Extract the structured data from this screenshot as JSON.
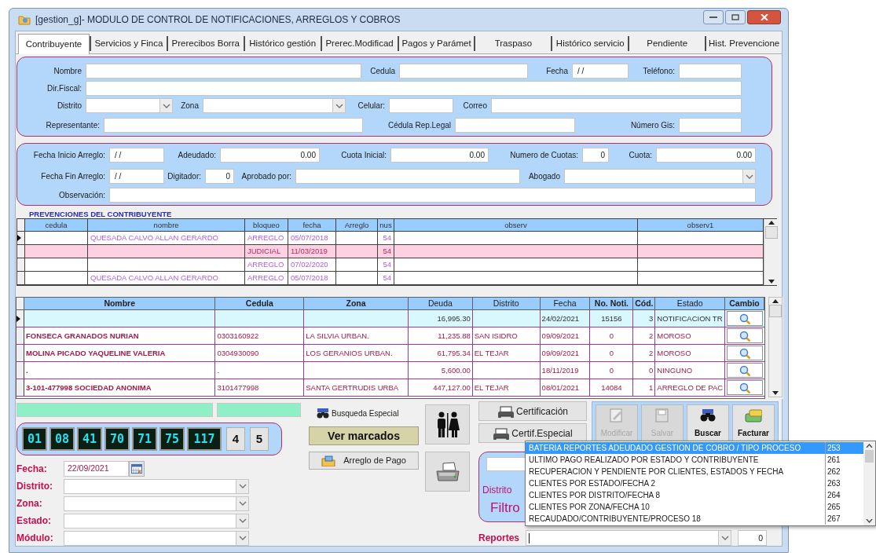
{
  "window": {
    "title": "[gestion_g]- MODULO DE CONTROL DE NOTIFICACIONES, ARREGLOS Y COBROS"
  },
  "tabs": [
    {
      "label": "Contribuyente",
      "selected": true
    },
    {
      "label": "Servicios y Finca",
      "selected": false
    },
    {
      "label": "Prerecibos Borra",
      "selected": false
    },
    {
      "label": "Histórico gestión",
      "selected": false
    },
    {
      "label": "Prerec.Modificad",
      "selected": false
    },
    {
      "label": "Pagos y Parámet",
      "selected": false
    },
    {
      "label": "Traspaso",
      "selected": false
    },
    {
      "label": "Histórico servicio",
      "selected": false
    },
    {
      "label": "Pendiente",
      "selected": false
    },
    {
      "label": "Hist. Prevencione",
      "selected": false
    }
  ],
  "contribuyente_form": {
    "lines": [
      {
        "items": [
          {
            "label": "Nombre",
            "kind": "text"
          },
          {
            "label": "Cedula",
            "kind": "text"
          },
          {
            "label": "Fecha",
            "kind": "text",
            "value": "/ /"
          },
          {
            "label": "Teléfono:",
            "kind": "text"
          }
        ]
      },
      {
        "items": [
          {
            "label": "Dir.Fiscal:",
            "kind": "text"
          }
        ]
      },
      {
        "items": [
          {
            "label": "Distrito",
            "kind": "combo"
          },
          {
            "label": "Zona",
            "kind": "combo"
          },
          {
            "label": "Celular:",
            "kind": "text"
          },
          {
            "label": "Correo",
            "kind": "text"
          }
        ]
      },
      {
        "items": [
          {
            "label": "Representante:",
            "kind": "text"
          },
          {
            "label": "Cédula Rep.Legal",
            "kind": "text"
          },
          {
            "label": "Número Gis:",
            "kind": "text"
          }
        ]
      }
    ]
  },
  "arreglo_form": {
    "lines": [
      {
        "items": [
          {
            "label": "Fecha Inicio Arreglo:",
            "kind": "text",
            "value": "/ /"
          },
          {
            "label": "Adeudado:",
            "kind": "text",
            "value": "0.00"
          },
          {
            "label": "Cuota Inicial:",
            "kind": "text",
            "value": "0.00"
          },
          {
            "label": "Numero de Cuotas:",
            "kind": "text",
            "value": "0"
          },
          {
            "label": "Cuota:",
            "kind": "text",
            "value": "0.00"
          }
        ]
      },
      {
        "items": [
          {
            "label": "Fecha Fin Arreglo:",
            "kind": "text",
            "value": "/ /"
          },
          {
            "label": "Digitador:",
            "kind": "text",
            "value": "0"
          },
          {
            "label": "Aprobado por:",
            "kind": "text"
          },
          {
            "label": "Abogado",
            "kind": "combo"
          }
        ]
      },
      {
        "items": [
          {
            "label": "Observación:",
            "kind": "text"
          }
        ]
      }
    ]
  },
  "prevenciones": {
    "title": "PREVENCIONES DEL CONTRIBUYENTE",
    "columns": [
      "cedula",
      "nombre",
      "bloqueo",
      "fecha",
      "Arreglo",
      "nus",
      "observ",
      "observ1"
    ],
    "rows": [
      {
        "current": true,
        "highlight": false,
        "cells": [
          null,
          "QUESADA CALVO ALLAN GERARDO",
          "ARREGLO",
          "05/07/2018",
          null,
          "54",
          null,
          null
        ]
      },
      {
        "current": false,
        "highlight": true,
        "cells": [
          null,
          null,
          "JUDICIAL",
          "11/03/2019",
          null,
          "54",
          null,
          null
        ]
      },
      {
        "current": false,
        "highlight": false,
        "cells": [
          null,
          null,
          "ARREGLO",
          "07/02/2020",
          null,
          "54",
          null,
          null
        ]
      },
      {
        "current": false,
        "highlight": false,
        "cells": [
          null,
          "QUESADA CALVO ALLAN GERARDO",
          "ARREGLO",
          "05/07/2018",
          null,
          "54",
          null,
          null
        ]
      }
    ]
  },
  "contribuyentes": {
    "columns": [
      {
        "label": "Nombre",
        "bold": true
      },
      {
        "label": "Cedula",
        "bold": true
      },
      {
        "label": "Zona",
        "bold": true
      },
      {
        "label": "Deuda",
        "bold": false
      },
      {
        "label": "Distrito",
        "bold": false
      },
      {
        "label": "Fecha",
        "bold": false
      },
      {
        "label": "No. Noti.",
        "bold": true
      },
      {
        "label": "Cód.",
        "bold": true
      },
      {
        "label": "Estado",
        "bold": false
      },
      {
        "label": "Cambio",
        "bold": true
      }
    ],
    "rows": [
      {
        "current": true,
        "cells": [
          null,
          null,
          null,
          "16,995.30",
          null,
          "24/02/2021",
          "15156",
          "3",
          "NOTIFICACION TR"
        ]
      },
      {
        "current": false,
        "cells": [
          "FONSECA GRANADOS NURIAN",
          "0303160922",
          "LA SILVIA URBAN.",
          "11,235.88",
          "SAN ISIDRO",
          "09/09/2021",
          "0",
          "2",
          "MOROSO"
        ]
      },
      {
        "current": false,
        "cells": [
          "MOLINA PICADO YAQUELINE VALERIA",
          "0304930090",
          "LOS GERANIOS URBAN.",
          "61,795.34",
          "EL TEJAR",
          "09/09/2021",
          "0",
          "2",
          "MOROSO"
        ]
      },
      {
        "current": false,
        "cells": [
          ".",
          ".",
          null,
          "5,600.00",
          null,
          "18/11/2019",
          "0",
          "0",
          "NINGUNO"
        ]
      },
      {
        "current": false,
        "cells": [
          "3-101-477998 SOCIEDAD ANONIMA",
          "3101477998",
          "SANTA GERTRUDIS URBA",
          "447,127.00",
          "EL TEJAR",
          "08/01/2021",
          "14084",
          "1",
          "ARREGLO DE PAC"
        ]
      }
    ]
  },
  "counter": {
    "digits": [
      "01",
      "08",
      "41",
      "70",
      "71",
      "75",
      "117"
    ],
    "boxes": [
      "4",
      "5"
    ]
  },
  "filters": [
    {
      "label": "Fecha:",
      "kind": "date",
      "value": "22/09/2021"
    },
    {
      "label": "Distrito:",
      "kind": "combo"
    },
    {
      "label": "Zona:",
      "kind": "combo"
    },
    {
      "label": "Estado:",
      "kind": "combo"
    },
    {
      "label": "Módulo:",
      "kind": "combo"
    }
  ],
  "busqueda_especial": "Busqueda Especial",
  "ver_marcados": "Ver marcados",
  "arreglo_de_pago": "Arreglo de Pago",
  "certificacion": "Certificación",
  "certif_especial": "Certif.Especial",
  "toolbar": [
    {
      "label": "Modificar",
      "disabled": true
    },
    {
      "label": "Salvar",
      "disabled": true
    },
    {
      "label": "Buscar",
      "disabled": false
    },
    {
      "label": "Facturar",
      "disabled": false
    }
  ],
  "filtros_panel": {
    "label": "Distrito",
    "title": "Filtro"
  },
  "reportes": {
    "label": "Reportes",
    "count": "0"
  },
  "reportes_list": [
    {
      "text": "BATERIA REPORTES ADEUDADO GESTION DE COBRO / TIPO PROCESO",
      "code": "253",
      "selected": true
    },
    {
      "text": "ULTIMO PAGO REALIZADO POR ESTADO Y CONTRIBUYENTE",
      "code": "261",
      "selected": false
    },
    {
      "text": "RECUPERACION Y PENDIENTE POR CLIENTES, ESTADOS Y FECHA",
      "code": "262",
      "selected": false
    },
    {
      "text": "CLIENTES POR ESTADO/FECHA 2",
      "code": "263",
      "selected": false
    },
    {
      "text": "CLIENTES POR DISTRITO/FECHA 8",
      "code": "264",
      "selected": false
    },
    {
      "text": "CLIENTES POR ZONA/FECHA 10",
      "code": "265",
      "selected": false
    },
    {
      "text": "RECAUDADO/CONTRIBUYENTE/PROCESO 18",
      "code": "267",
      "selected": false
    }
  ]
}
